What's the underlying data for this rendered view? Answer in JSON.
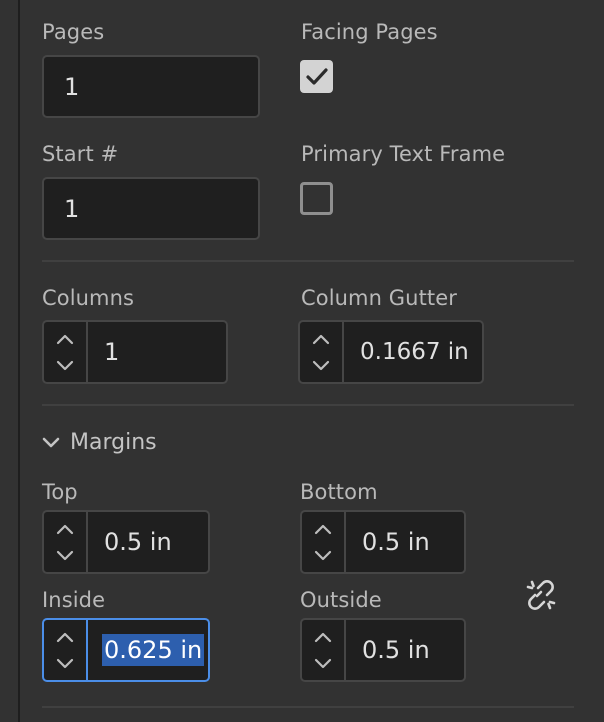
{
  "pages": {
    "label": "Pages",
    "value": "1"
  },
  "facing_pages": {
    "label": "Facing Pages",
    "checked": true
  },
  "start_number": {
    "label": "Start #",
    "value": "1"
  },
  "primary_text_frame": {
    "label": "Primary Text Frame",
    "checked": false
  },
  "columns": {
    "label": "Columns",
    "value": "1"
  },
  "column_gutter": {
    "label": "Column Gutter",
    "value": "0.1667 in"
  },
  "margins": {
    "title": "Margins",
    "expanded": true,
    "top": {
      "label": "Top",
      "value": "0.5 in"
    },
    "bottom": {
      "label": "Bottom",
      "value": "0.5 in"
    },
    "inside": {
      "label": "Inside",
      "value": "0.625 in",
      "focused": true,
      "selected": true
    },
    "outside": {
      "label": "Outside",
      "value": "0.5 in"
    },
    "link_icon": "broken-link-icon"
  },
  "colors": {
    "panel_bg": "#323232",
    "field_bg": "#1f1f1f",
    "field_border": "#464646",
    "focus_border": "#4b8ee8",
    "selection_bg": "#2d5fae",
    "label_text": "#b9b9b9",
    "value_text": "#e1e1e1"
  }
}
